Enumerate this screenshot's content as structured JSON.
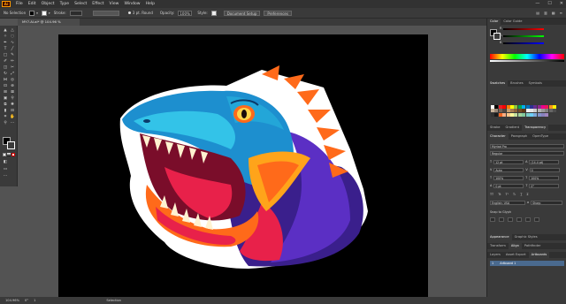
{
  "menubar": {
    "logo": "Ai",
    "items": [
      "File",
      "Edit",
      "Object",
      "Type",
      "Select",
      "Effect",
      "View",
      "Window",
      "Help"
    ],
    "window_controls": [
      "—",
      "☐",
      "✕"
    ]
  },
  "control_bar": {
    "selection_label": "No Selection",
    "stroke_label": "Stroke:",
    "brush_label": "3 pt. Round",
    "opacity_label": "Opacity:",
    "opacity_value": "100%",
    "style_label": "Style:",
    "doc_setup": "Document Setup",
    "preferences": "Preferences"
  },
  "tab": {
    "title": "MY7.AI.ai* @ 104.96 % (RGB/Preview)",
    "close": "×"
  },
  "status": {
    "zoom": "104.96%",
    "angle": "0°",
    "artboard": "1",
    "selection": "Selection"
  },
  "right_panel": {
    "color_tabs": [
      "Color",
      "Color Guide"
    ],
    "color_channels": [
      "R",
      "G",
      "B"
    ],
    "swatch_tabs": [
      "Swatches",
      "Brushes",
      "Symbols"
    ],
    "stroke_tabs": [
      "Stroke",
      "Gradient",
      "Transparency"
    ],
    "char_tabs": [
      "Character",
      "Paragraph",
      "OpenType"
    ],
    "font_search": "Myriad Pro",
    "font_style": "Regular",
    "font_size": "12 pt",
    "leading": "(14.4 pt)",
    "kerning": "Auto",
    "tracking": "0",
    "scale_h": "100%",
    "scale_v": "100%",
    "baseline": "0 pt",
    "rotation": "0°",
    "language": "English: USA",
    "aa": "Sharp",
    "snap": "Snap to Glyph",
    "appearance_tabs": [
      "Appearance",
      "Graphic Styles"
    ],
    "transform_tabs": [
      "Transform",
      "Align",
      "Pathfinder"
    ],
    "layer_tabs": [
      "Layers",
      "Asset Export",
      "Artboards"
    ],
    "artboard_row": "1",
    "artboard_name": "Artboard 1",
    "swatch_colors": [
      "#ffffff",
      "#000000",
      "#ed1c24",
      "#ff0000",
      "#ff7f00",
      "#ffff00",
      "#8cc63f",
      "#00a651",
      "#00aeef",
      "#0072bc",
      "#2e3192",
      "#662d91",
      "#92278f",
      "#ec008c",
      "#ed145b",
      "#f7941d",
      "#fff200",
      "#c7b299",
      "#998675",
      "#736357",
      "#534741",
      "#c69c6d",
      "#a67c52",
      "#8c6239",
      "#754c24",
      "#603913",
      "#f2f2f2",
      "#e6e6e6",
      "#cccccc",
      "#b3b3b3",
      "#999999",
      "#808080",
      "#666666",
      "#4d4d4d",
      "#333333",
      "#1a1a1a",
      "#f26522",
      "#f9ad81",
      "#fdc689",
      "#fff799",
      "#c4df9b",
      "#a3d39c",
      "#82ca9c",
      "#7accc8",
      "#6dcff6",
      "#7da7d9",
      "#8393ca",
      "#8781bd",
      "#a186be"
    ]
  },
  "colors": {
    "menubar": "#323232",
    "panel": "#3a3a3a",
    "workspace": "#535353",
    "artboard": "#000000",
    "accent": "#ff9a00"
  }
}
